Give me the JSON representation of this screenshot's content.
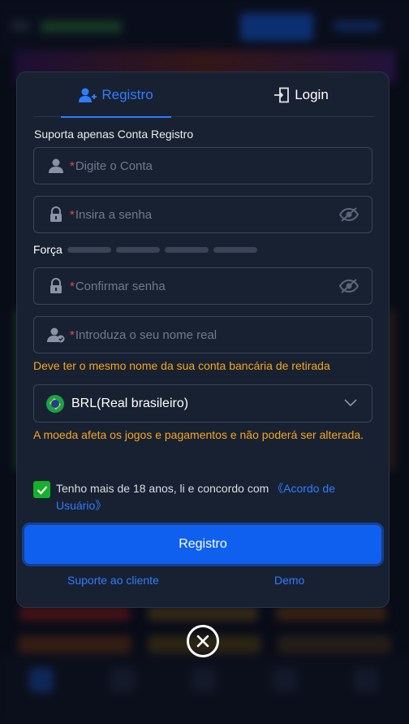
{
  "tabs": {
    "register": "Registro",
    "login": "Login"
  },
  "form": {
    "hint": "Suporta apenas Conta Registro",
    "required_mark": "*",
    "account_placeholder": "Digite o Conta",
    "password_placeholder": "Insira a senha",
    "strength_label": "Força",
    "confirm_placeholder": "Confirmar senha",
    "realname_placeholder": "Introduza o seu nome real",
    "realname_warning": "Deve ter o mesmo nome da sua conta bancária de retirada",
    "currency_value": "BRL(Real brasileiro)",
    "currency_warning": "A moeda afeta os jogos e pagamentos e não poderá ser alterada.",
    "agree_text": "Tenho mais de 18 anos, li e concordo com ",
    "agree_link": "《Acordo de Usuário》",
    "agree_checked": true,
    "submit_label": "Registro"
  },
  "footer_links": {
    "support": "Suporte ao cliente",
    "demo": "Demo"
  },
  "colors": {
    "accent": "#2f7dff",
    "warning": "#f5a623",
    "required": "#f04545",
    "checkbox": "#17b02a",
    "modal_bg": "#182131"
  },
  "icons": {
    "register_tab": "user-plus-icon",
    "login_tab": "login-door-icon",
    "account": "user-icon",
    "password": "lock-icon",
    "visibility": "eye-off-icon",
    "realname": "user-check-icon",
    "currency": "brazil-flag-icon",
    "dropdown": "chevron-down-icon",
    "close": "close-icon"
  }
}
